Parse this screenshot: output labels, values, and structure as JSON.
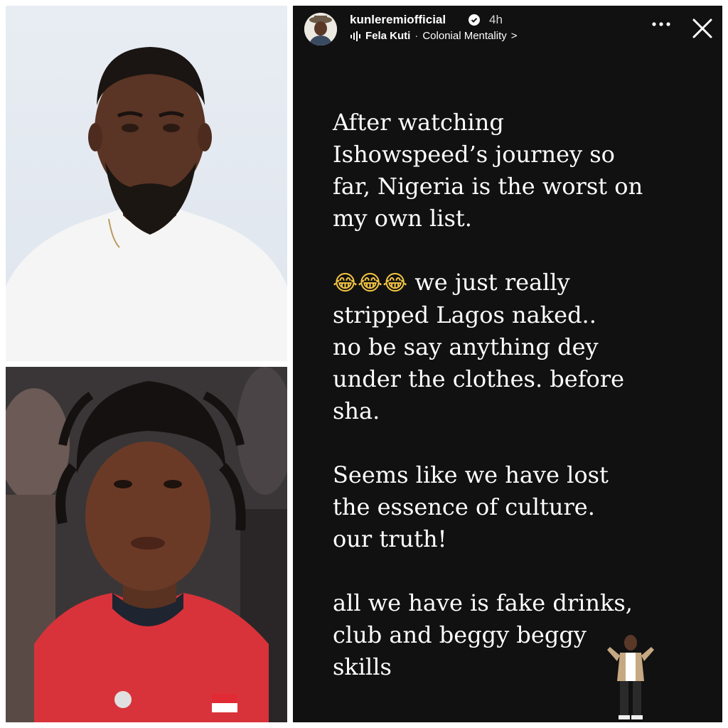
{
  "story": {
    "username": "kunleremiofficial",
    "time": "4h",
    "music_artist": "Fela Kuti",
    "music_separator": "·",
    "music_song": "Colonial Mentality",
    "music_chevron": ">",
    "paragraphs": [
      "After watching\nIshowspeed’s journey so\nfar, Nigeria is the worst on\nmy own list.",
      "we just really\nstripped Lagos naked..\nno be say anything dey\nunder the clothes. before\nsha.",
      "Seems like we have lost\nthe essence of culture.\nour truth!",
      "all we have is fake drinks,\nclub and beggy beggy\nskills"
    ],
    "emoji": "😂😂😂",
    "icons": [
      "verified-badge-icon",
      "music-bars-icon",
      "more-icon",
      "close-icon"
    ],
    "colors": {
      "background": "#111111",
      "text": "#ffffff",
      "verified": "#3897f0"
    }
  },
  "photos": {
    "top_shirt_color": "#f5f5f5",
    "bottom_jersey_color": "#d8333a"
  }
}
